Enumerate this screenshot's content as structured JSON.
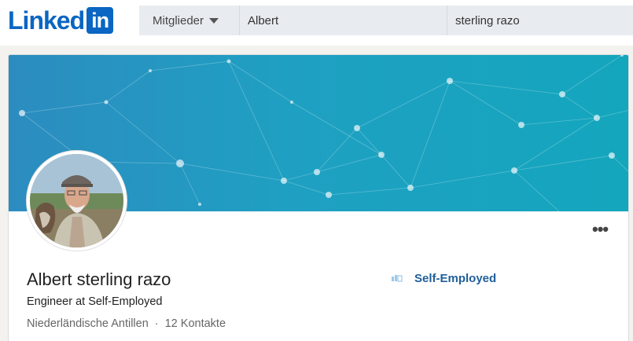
{
  "brand": {
    "logo_text": "Linked",
    "logo_box": "in",
    "color": "#0a66c2"
  },
  "search": {
    "category": "Mitglieder",
    "first_name": "Albert",
    "last_name": "sterling razo"
  },
  "profile": {
    "name": "Albert sterling razo",
    "headline": "Engineer at Self-Employed",
    "location": "Niederländische Antillen",
    "separator": "·",
    "connections": "12 Kontakte",
    "more_label": "•••",
    "company": "Self-Employed"
  },
  "icons": {
    "category_caret": "caret-down-icon",
    "more": "more-options-icon",
    "company": "company-logo-icon"
  }
}
